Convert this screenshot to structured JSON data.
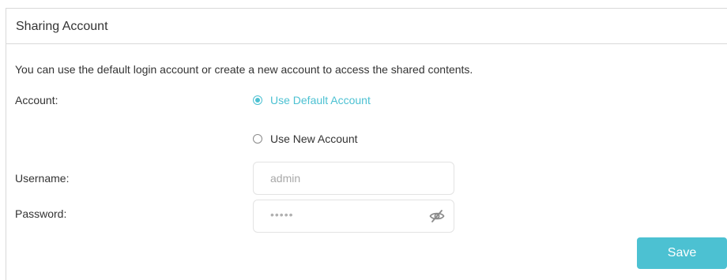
{
  "panel": {
    "title": "Sharing Account"
  },
  "description": "You can use the default login account or create a new account to access the shared contents.",
  "account": {
    "label": "Account:",
    "options": [
      {
        "label": "Use Default Account",
        "selected": true
      },
      {
        "label": "Use New Account",
        "selected": false
      }
    ]
  },
  "username": {
    "label": "Username:",
    "value": "admin"
  },
  "password": {
    "label": "Password:",
    "value": "•••••",
    "toggle_icon": "eye-slash-icon"
  },
  "save_label": "Save",
  "colors": {
    "accent": "#4cc1d2",
    "text": "#333333",
    "border": "#d9d9d9",
    "placeholder": "#a8a8a8"
  }
}
